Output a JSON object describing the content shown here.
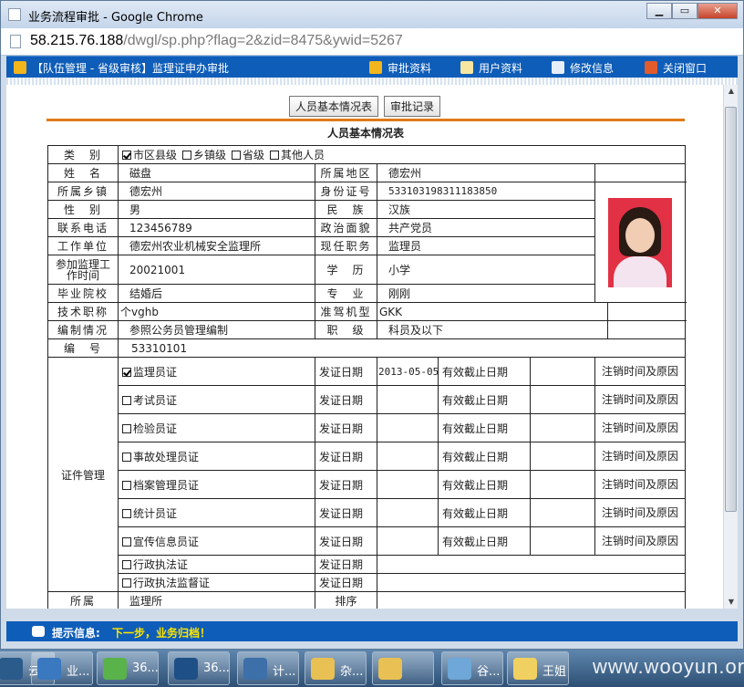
{
  "window": {
    "title": "业务流程审批 - Google Chrome"
  },
  "address": {
    "host": "58.215.76.188",
    "path": "/dwgl/sp.php?flag=2&zid=8475&ywid=5267"
  },
  "nav": {
    "breadcrumb": "【队伍管理 - 省级审核】监理证申办审批",
    "items": [
      "审批资料",
      "用户资料",
      "修改信息",
      "关闭窗口"
    ]
  },
  "tabs": [
    "人员基本情况表",
    "审批记录"
  ],
  "form": {
    "title": "人员基本情况表",
    "category_label": "类　别",
    "categories": [
      {
        "label": "市区县级",
        "checked": true
      },
      {
        "label": "乡镇级",
        "checked": false
      },
      {
        "label": "省级",
        "checked": false
      },
      {
        "label": "其他人员",
        "checked": false
      }
    ],
    "rows": [
      {
        "l1": "姓　名",
        "v1": "磁盘",
        "l2": "所属地区",
        "v2": "德宏州"
      },
      {
        "l1": "所属乡镇",
        "v1": "德宏州",
        "l2": "身份证号",
        "v2": "533103198311183850"
      },
      {
        "l1": "性　别",
        "v1": "男",
        "l2": "民　族",
        "v2": "汉族"
      },
      {
        "l1": "联系电话",
        "v1": "123456789",
        "l2": "政治面貌",
        "v2": "共产党员"
      },
      {
        "l1": "工作单位",
        "v1": "德宏州农业机械安全监理所",
        "l2": "现任职务",
        "v2": "监理员"
      },
      {
        "l1": "参加监理工作时间",
        "v1": "20021001",
        "l2": "学　历",
        "v2": "小学"
      },
      {
        "l1": "毕业院校",
        "v1": "结婚后",
        "l2": "专　业",
        "v2": "刚刚"
      },
      {
        "l1": "技术职称",
        "v1": "个vghb",
        "l2": "准驾机型",
        "v2": "GKK"
      },
      {
        "l1": "编制情况",
        "v1": "参照公务员管理编制",
        "l2": "职　级",
        "v2": "科员及以下"
      }
    ],
    "serial": {
      "label": "编　号",
      "value": "53310101"
    },
    "cert_group_label": "证件管理",
    "issue_label": "发证日期",
    "expire_label": "有效截止日期",
    "cancel_note": "注销时间及原因",
    "certs": [
      {
        "name": "监理员证",
        "checked": true,
        "issue": "2013-05-05"
      },
      {
        "name": "考试员证",
        "checked": false,
        "issue": ""
      },
      {
        "name": "检验员证",
        "checked": false,
        "issue": ""
      },
      {
        "name": "事故处理员证",
        "checked": false,
        "issue": ""
      },
      {
        "name": "档案管理员证",
        "checked": false,
        "issue": ""
      },
      {
        "name": "统计员证",
        "checked": false,
        "issue": ""
      },
      {
        "name": "宣传信息员证",
        "checked": false,
        "issue": ""
      }
    ],
    "law_certs": [
      {
        "name": "行政执法证",
        "checked": false
      },
      {
        "name": "行政执法监督证",
        "checked": false
      }
    ],
    "affil": {
      "label": "所属",
      "value": "监理所",
      "sort_label": "排序"
    }
  },
  "tip": {
    "label": "提示信息:",
    "message": "下一步，业务归档！"
  },
  "taskbar": [
    "云...",
    "业...",
    "36...",
    "36...",
    "计...",
    "杂...",
    "",
    "谷...",
    "王姐"
  ],
  "watermark": "www.wooyun.org"
}
